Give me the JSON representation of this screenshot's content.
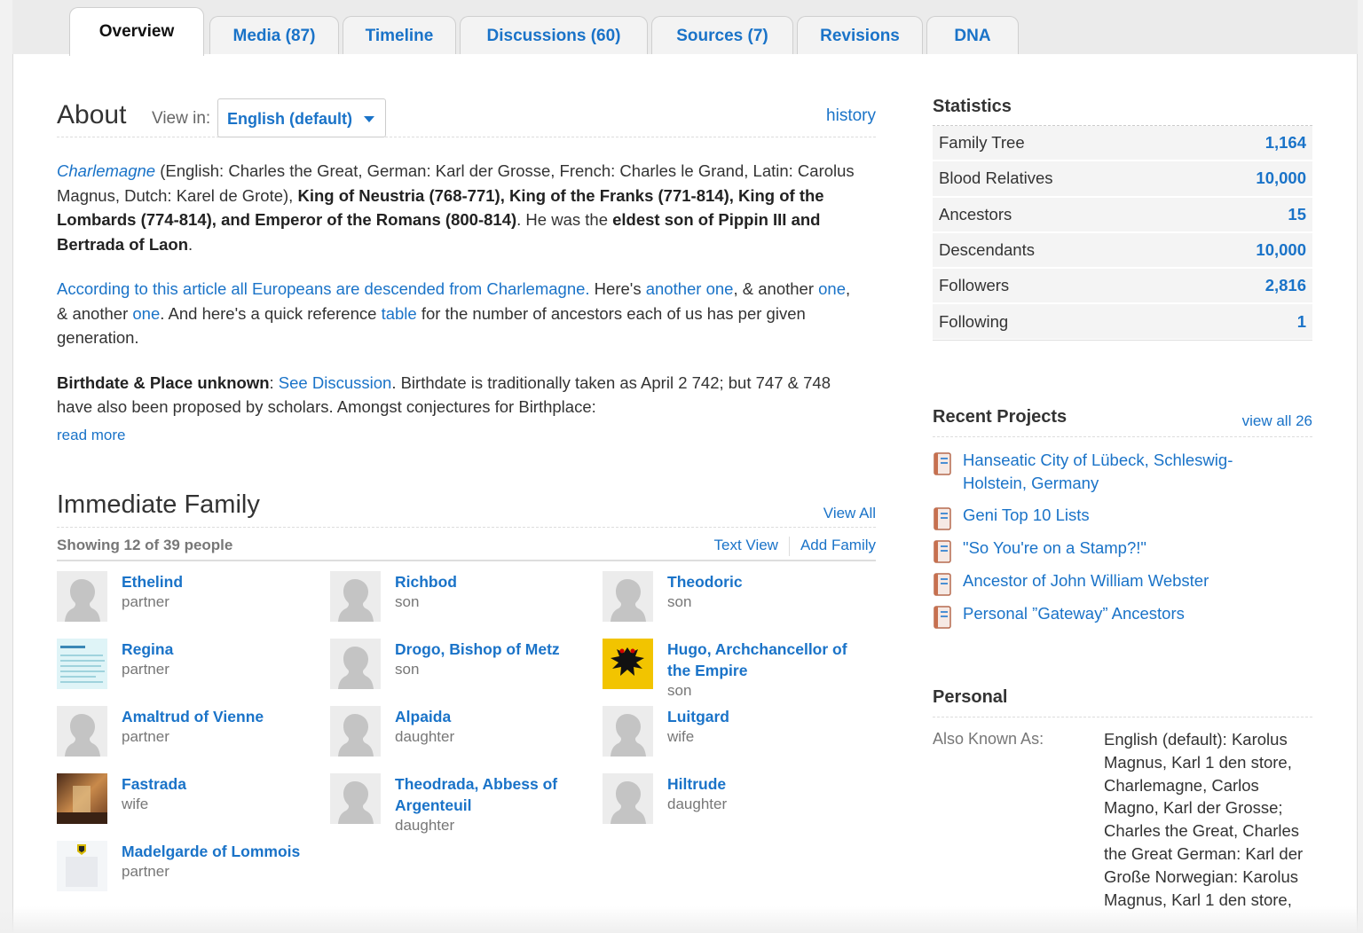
{
  "tabs": [
    {
      "label": "Overview"
    },
    {
      "label": "Media (87)"
    },
    {
      "label": "Timeline"
    },
    {
      "label": "Discussions (60)"
    },
    {
      "label": "Sources (7)"
    },
    {
      "label": "Revisions"
    },
    {
      "label": "DNA"
    }
  ],
  "about": {
    "title": "About",
    "view_in_label": "View in:",
    "language": "English (default)",
    "history_link": "history",
    "p1": {
      "name_link": "Charlemagne",
      "t1": " (English: Charles the Great, German: Karl der Grosse, French: Charles le Grand, Latin: Carolus Magnus, Dutch: Karel de Grote), ",
      "b1": "King of Neustria (768-771), King of the Franks (771-814), King of the Lombards (774-814), and Emperor of the Romans (800-814)",
      "t2": ". He was the ",
      "b2": "eldest son of Pippin III and Bertrada of Laon",
      "t3": "."
    },
    "p2": {
      "l1": "According to this article all Europeans are descended from Charlemagne.",
      "t1": " Here's ",
      "l2": "another one",
      "t2": ", & another ",
      "l3": "one",
      "t3": ", & another ",
      "l4": "one",
      "t4": ". And here's a quick reference ",
      "l5": "table",
      "t5": " for the number of ancestors each of us has per given generation."
    },
    "p3": {
      "b1": "Birthdate & Place unknown",
      "t1": ": ",
      "l1": "See Discussion",
      "t2": ". Birthdate is traditionally taken as April 2 742; but 747 & 748 have also been proposed by scholars. Amongst conjectures for Birthplace:"
    },
    "read_more": "read more"
  },
  "family": {
    "title": "Immediate Family",
    "view_all": "View All",
    "showing": "Showing 12 of 39 people",
    "text_view": "Text View",
    "add_family": "Add Family",
    "members": [
      {
        "name": "Ethelind",
        "relation": "partner",
        "avatar": "silhouette"
      },
      {
        "name": "Richbod",
        "relation": "son",
        "avatar": "silhouette"
      },
      {
        "name": "Theodoric",
        "relation": "son",
        "avatar": "silhouette"
      },
      {
        "name": "Regina",
        "relation": "partner",
        "avatar": "document"
      },
      {
        "name": "Drogo, Bishop of Metz",
        "relation": "son",
        "avatar": "silhouette"
      },
      {
        "name": "Hugo, Archchancellor of the Empire",
        "relation": "son",
        "avatar": "eagle"
      },
      {
        "name": "Amaltrud of Vienne",
        "relation": "partner",
        "avatar": "silhouette"
      },
      {
        "name": "Alpaida",
        "relation": "daughter",
        "avatar": "silhouette"
      },
      {
        "name": "Luitgard",
        "relation": "wife",
        "avatar": "silhouette"
      },
      {
        "name": "Fastrada",
        "relation": "wife",
        "avatar": "painting"
      },
      {
        "name": "Theodrada, Abbess of Argenteuil",
        "relation": "daughter",
        "avatar": "silhouette"
      },
      {
        "name": "Hiltrude",
        "relation": "daughter",
        "avatar": "silhouette"
      },
      {
        "name": "Madelgarde of Lommois",
        "relation": "partner",
        "avatar": "crest"
      }
    ]
  },
  "statistics": {
    "title": "Statistics",
    "rows": [
      {
        "label": "Family Tree",
        "value": "1,164"
      },
      {
        "label": "Blood Relatives",
        "value": "10,000"
      },
      {
        "label": "Ancestors",
        "value": "15"
      },
      {
        "label": "Descendants",
        "value": "10,000"
      },
      {
        "label": "Followers",
        "value": "2,816"
      },
      {
        "label": "Following",
        "value": "1"
      }
    ]
  },
  "projects": {
    "title": "Recent Projects",
    "view_all": "view all 26",
    "items": [
      {
        "label": "Hanseatic City of Lübeck, Schleswig-Holstein, Germany"
      },
      {
        "label": "Geni Top 10 Lists"
      },
      {
        "label": "\"So You're on a Stamp?!\""
      },
      {
        "label": "Ancestor of John William Webster"
      },
      {
        "label": "Personal ”Gateway” Ancestors"
      }
    ]
  },
  "personal": {
    "title": "Personal",
    "aka_label": "Also Known As:",
    "aka_value": "English (default): Karolus Magnus, Karl 1 den store, Charlemagne, Carlos Magno, Karl der Grosse; Charles the Great, Charles the Great German: Karl der Große Norwegian: Karolus Magnus, Karl 1 den store,"
  },
  "colors": {
    "link": "#1a73c8",
    "text": "#333333"
  }
}
